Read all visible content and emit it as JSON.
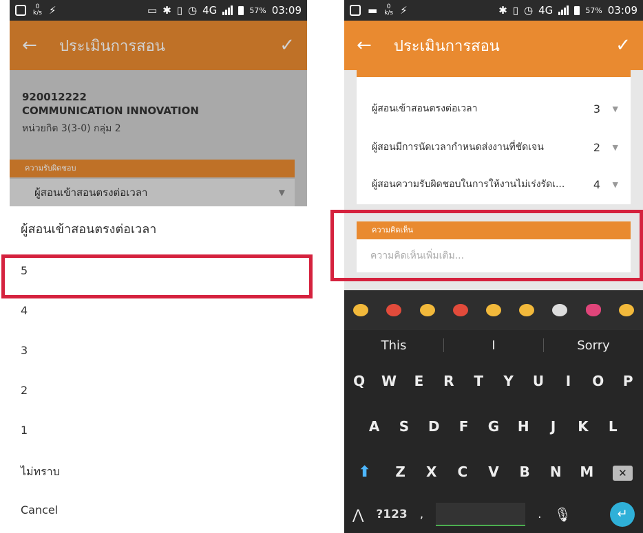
{
  "status_bar": {
    "left_speed": "0\nk/s",
    "battery_pct": "57%",
    "network": "4G",
    "time": "03:09"
  },
  "app": {
    "title": "ประเมินการสอน",
    "back_icon": "arrow-left-icon",
    "confirm_icon": "check-icon",
    "accent": "#e98a30"
  },
  "left": {
    "course_code": "920012222",
    "course_name": "COMMUNICATION INNOVATION",
    "course_meta": "หน่วยกิต 3(3-0) กลุ่ม 2",
    "section_label": "ความรับผิดชอบ",
    "question_value": "ผู้สอนเข้าสอนตรงต่อเวลา",
    "dialog": {
      "title": "ผู้สอนเข้าสอนตรงต่อเวลา",
      "options": [
        "5",
        "4",
        "3",
        "2",
        "1",
        "ไม่ทราบ"
      ],
      "cancel": "Cancel",
      "highlighted_option": "5"
    }
  },
  "right": {
    "questions": [
      {
        "text": "ผู้สอนเข้าสอนตรงต่อเวลา",
        "value": "3"
      },
      {
        "text": "ผู้สอนมีการนัดเวลากำหนดส่งงานที่ชัดเจน",
        "value": "2"
      },
      {
        "text": "ผู้สอนความรับผิดชอบในการให้งานไม่เร่งรัดเ...",
        "value": "4"
      }
    ],
    "comment_section_label": "ความคิดเห็น",
    "comment_placeholder": "ความคิดเห็นเพิ่มเติม..."
  },
  "keyboard": {
    "suggestions": [
      "This",
      "I",
      "Sorry"
    ],
    "row1": [
      "Q",
      "W",
      "E",
      "R",
      "T",
      "Y",
      "U",
      "I",
      "O",
      "P"
    ],
    "row2": [
      "A",
      "S",
      "D",
      "F",
      "G",
      "H",
      "J",
      "K",
      "L"
    ],
    "row3": [
      "Z",
      "X",
      "C",
      "V",
      "B",
      "N",
      "M"
    ],
    "symbols_label": "?123",
    "comma": ",",
    "period": "."
  },
  "highlight_color": "#d5223e"
}
